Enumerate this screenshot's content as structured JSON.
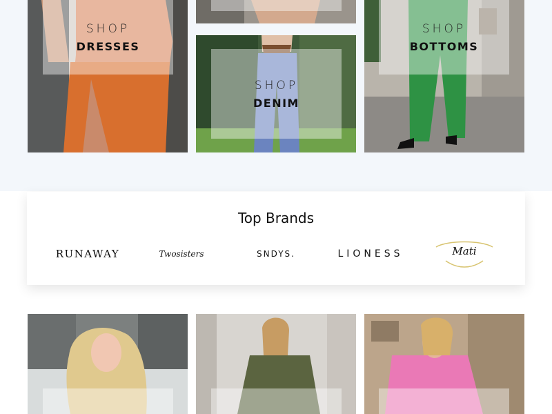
{
  "tiles_top": [
    {
      "shop": "SHOP",
      "category": "DRESSES"
    },
    {
      "shop": "SHOP",
      "category": "DENIM"
    },
    {
      "shop": "SHOP",
      "category": "BOTTOMS"
    }
  ],
  "brands": {
    "title": "Top Brands",
    "items": [
      {
        "label": "RUNAWAY"
      },
      {
        "label": "Twosisters"
      },
      {
        "label": "SNDYS."
      },
      {
        "label": "LIONESS"
      },
      {
        "label": "Mati"
      }
    ]
  },
  "colors": {
    "page_bg_top": "#f3f7fb",
    "overlay": "rgba(255,255,255,0.42)",
    "mati_accent": "#d8c470"
  }
}
